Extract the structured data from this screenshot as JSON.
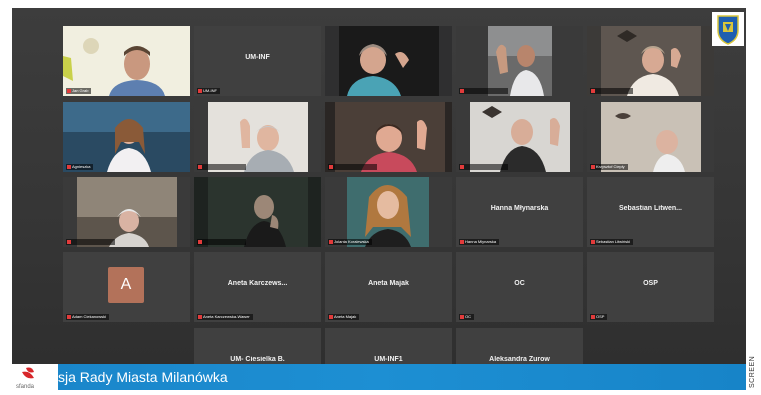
{
  "meeting": {
    "row1": {
      "t1_label": "Jan Grab",
      "t2_name": "UM-INF",
      "t2_label": "UM-INF"
    },
    "row2": {
      "t1_label": "Agnieszka",
      "t5_label": "Krzysztof Ciepły"
    },
    "row3": {
      "t3_label": "Jolanta Koralewska",
      "t4_name": "Hanna Młynarska",
      "t4_label": "Hanna Młynarska",
      "t5_name": "Sebastian Litwen...",
      "t5_label": "Sebastian Litwiński"
    },
    "row4": {
      "t1_avatar": "A",
      "t1_label": "Adam Ciekanowski",
      "t2_name": "Aneta Karczews...",
      "t2_label": "Aneta Karczewska-Wawer",
      "t3_name": "Aneta Majak",
      "t3_label": "Aneta Majak",
      "t4_name": "OC",
      "t4_label": "OC",
      "t5_name": "OSP",
      "t5_label": "OSP"
    },
    "row5": {
      "t2_name": "UM- Ciesielka B.",
      "t3_name": "UM-INF1",
      "t4_name": "Aleksandra Żurow"
    }
  },
  "banner": {
    "title": "sja Rady Miasta Milanówka",
    "logo_text": "sfanda"
  },
  "credit": "SCREEN",
  "colors": {
    "grid_bg": "#363636",
    "tile_bg": "#3a3a3a",
    "active_border": "#d6e23a",
    "banner_blue": "#1d8fd3",
    "muted_red": "#e23b3b",
    "avatar_bg": "#b3725a"
  }
}
